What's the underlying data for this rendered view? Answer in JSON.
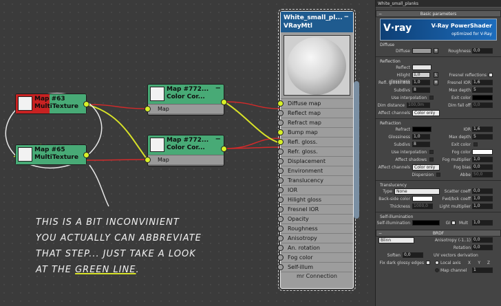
{
  "material_name": "White_small_planks",
  "nodes": {
    "multitex1": {
      "line1": "Map #63",
      "line2": "MultiTexture"
    },
    "multitex2": {
      "line1": "Map #65",
      "line2": "MultiTexture"
    },
    "colorcor1": {
      "line1": "Map #772...",
      "line2": "Color Cor...",
      "port": "Map"
    },
    "colorcor2": {
      "line1": "Map #772...",
      "line2": "Color Cor...",
      "port": "Map"
    }
  },
  "vray_node": {
    "title": "White_small_pl...",
    "subtitle": "VRayMtl",
    "slots": [
      "Diffuse map",
      "Reflect map",
      "Refract map",
      "Bump map",
      "Refl. gloss.",
      "Refr. gloss.",
      "Displacement",
      "Environment",
      "Translucency",
      "IOR",
      "Hilight gloss",
      "Fresnel IOR",
      "Opacity",
      "Roughness",
      "Anisotropy",
      "An. rotation",
      "Fog color",
      "Self-illum"
    ],
    "footer": "mr Connection"
  },
  "annotation": {
    "line1": "This is a bit inconvinient",
    "line2": "you actually can abbreviate",
    "line3a": "that step... just take a look",
    "line4a": "at the ",
    "line4b": "green line",
    "line4c": "."
  },
  "panel": {
    "basic_params": "Basic parameters",
    "logo_brand": "V·ray",
    "logo_title": "V-Ray PowerShader",
    "logo_sub": "optimized for V-Ray",
    "diffuse_group": "Diffuse",
    "diffuse_label": "Diffuse",
    "m_label": "M",
    "roughness_label": "Roughness",
    "roughness_val": "0,0",
    "reflection_group": "Reflection",
    "reflect_label": "Reflect",
    "hilight_label": "Hilight glossiness",
    "hilight_val": "1,0",
    "l_label": "L",
    "fresnel_label": "Fresnel reflections",
    "refl_gloss_label": "Refl. glossiness",
    "refl_gloss_val": "1,0",
    "fresnel_ior_label": "Fresnel IOR",
    "fresnel_ior_val": "1,6",
    "subdivs_label": "Subdivs",
    "subdivs_val": "8",
    "maxdepth_label": "Max depth",
    "maxdepth_val": "5",
    "use_interp_label": "Use interpolation",
    "exit_color_label": "Exit color",
    "dim_dist_label": "Dim distance",
    "dim_dist_val": "100,0m",
    "dim_falloff_label": "Dim fall off",
    "dim_falloff_val": "0,0",
    "affect_ch_label": "Affect channels",
    "affect_ch_val": "Color only",
    "refraction_group": "Refraction",
    "refract_label": "Refract",
    "ior_label": "IOR",
    "ior_val": "1,6",
    "gloss_label": "Glossiness",
    "gloss_val": "1,0",
    "r_maxdepth_val": "5",
    "r_subdivs_val": "8",
    "fog_color_label": "Fog color",
    "affect_shadows_label": "Affect shadows",
    "fog_mult_label": "Fog multiplier",
    "fog_mult_val": "1,0",
    "fog_bias_label": "Fog bias",
    "fog_bias_val": "0,0",
    "r_affect_val": "Color only",
    "dispersion_label": "Dispersion",
    "abbe_label": "Abbe",
    "abbe_val": "50,0",
    "translucency_group": "Translucency",
    "type_label": "Type",
    "type_val": "None",
    "scatter_label": "Scatter coeff",
    "scatter_val": "0,0",
    "backside_label": "Back-side color",
    "fwdbck_label": "Fwd/bck coeff",
    "fwdbck_val": "1,0",
    "thickness_label": "Thickness",
    "thickness_val": "1000,0",
    "light_mult_label": "Light multiplier",
    "light_mult_val": "1,0",
    "selfillum_group": "Self-illumination",
    "selfillum_label": "Self-illumination",
    "gi_label": "GI",
    "mult_label": "Mult",
    "mult_val": "1,0",
    "brdf_head": "BRDF",
    "brdf_type": "Blinn",
    "aniso_label": "Anisotropy (-1..1)",
    "aniso_val": "0,0",
    "rotation_label": "Rotation",
    "rotation_val": "0,0",
    "soften_label": "Soften",
    "soften_val": "0,0",
    "uv_label": "UV vectors derivation",
    "fix_dark_label": "Fix dark glossy edges",
    "local_axis_label": "Local axis",
    "x_label": "X",
    "y_label": "Y",
    "z_label": "Z",
    "map_channel_label": "Map channel",
    "map_channel_val": "1"
  },
  "colors": {
    "node_green": "#48aa76",
    "port_yellow": "#d7f028",
    "wire_red": "#d22a2a",
    "wire_green": "#d8e228",
    "vray_blue": "#1f5b8f"
  }
}
